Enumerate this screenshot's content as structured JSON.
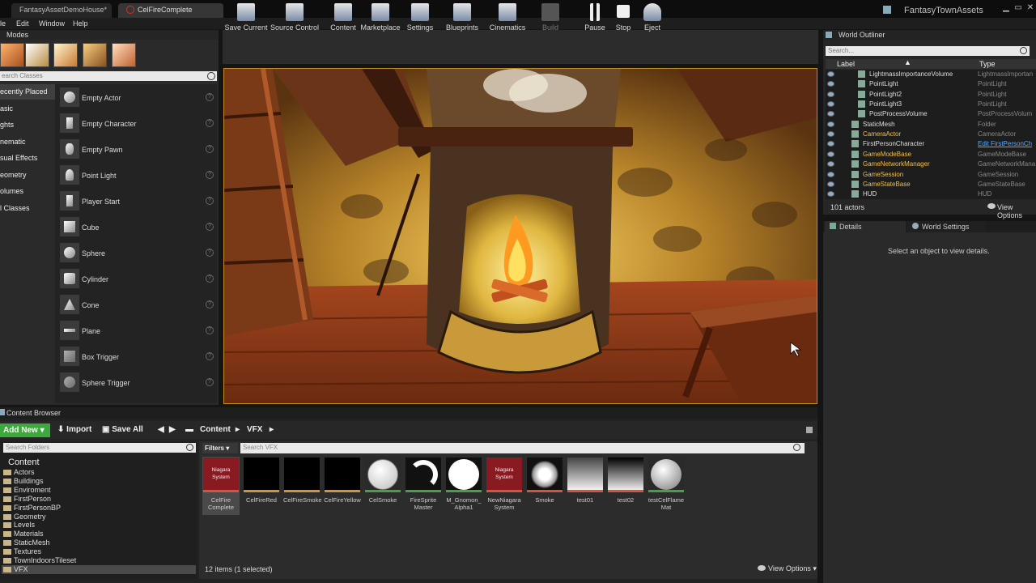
{
  "titlebar": {
    "tabs": [
      {
        "label": "FantasyAssetDemoHouse*"
      },
      {
        "label": "CelFireComplete"
      }
    ],
    "project_name": "FantasyTownAssets"
  },
  "menubar": {
    "items": [
      "le",
      "Edit",
      "Window",
      "Help"
    ]
  },
  "modes": {
    "title": "Modes",
    "search_placeholder": "earch Classes",
    "categories": [
      "ecently Placed",
      "asic",
      "ghts",
      "nematic",
      "sual Effects",
      "eometry",
      "olumes",
      "l Classes"
    ],
    "items": [
      "Empty Actor",
      "Empty Character",
      "Empty Pawn",
      "Point Light",
      "Player Start",
      "Cube",
      "Sphere",
      "Cylinder",
      "Cone",
      "Plane",
      "Box Trigger",
      "Sphere Trigger"
    ],
    "help_glyph": "?"
  },
  "toolbar": {
    "buttons": [
      {
        "label": "Save Current",
        "icon": "save-icon"
      },
      {
        "label": "Source Control",
        "icon": "source-control-icon"
      },
      {
        "label": "Content",
        "icon": "content-icon"
      },
      {
        "label": "Marketplace",
        "icon": "marketplace-icon"
      },
      {
        "label": "Settings",
        "icon": "settings-icon"
      },
      {
        "label": "Blueprints",
        "icon": "blueprints-icon"
      },
      {
        "label": "Cinematics",
        "icon": "cinematics-icon"
      },
      {
        "label": "Build",
        "icon": "build-icon"
      },
      {
        "label": "Pause",
        "icon": "pause-icon"
      },
      {
        "label": "Stop",
        "icon": "stop-icon"
      },
      {
        "label": "Eject",
        "icon": "eject-icon"
      }
    ]
  },
  "outliner": {
    "title": "World Outliner",
    "search_placeholder": "Search...",
    "col_label": "Label",
    "col_type": "Type",
    "rows": [
      {
        "label": "LightmassImportanceVolume",
        "type": "LightmassImportan",
        "indent": 2
      },
      {
        "label": "PointLight",
        "type": "PointLight",
        "indent": 2
      },
      {
        "label": "PointLight2",
        "type": "PointLight",
        "indent": 2
      },
      {
        "label": "PointLight3",
        "type": "PointLight",
        "indent": 2
      },
      {
        "label": "PostProcessVolume",
        "type": "PostProcessVolum",
        "indent": 2
      },
      {
        "label": "StaticMesh",
        "type": "Folder",
        "indent": 1
      },
      {
        "label": "CameraActor",
        "type": "CameraActor",
        "indent": 1,
        "highlight": true
      },
      {
        "label": "FirstPersonCharacter",
        "type": "Edit FirstPersonCh",
        "indent": 1,
        "link": true
      },
      {
        "label": "GameModeBase",
        "type": "GameModeBase",
        "indent": 1,
        "highlight": true
      },
      {
        "label": "GameNetworkManager",
        "type": "GameNetworkMana",
        "indent": 1,
        "highlight": true
      },
      {
        "label": "GameSession",
        "type": "GameSession",
        "indent": 1,
        "highlight": true
      },
      {
        "label": "GameStateBase",
        "type": "GameStateBase",
        "indent": 1,
        "highlight": true
      },
      {
        "label": "HUD",
        "type": "HUD",
        "indent": 1
      }
    ],
    "count": "101 actors",
    "view_options": "View Options"
  },
  "details": {
    "tabs": [
      "Details",
      "World Settings"
    ],
    "empty_text": "Select an object to view details."
  },
  "content_browser": {
    "title": "Content Browser",
    "add_new": "Add New",
    "import": "Import",
    "save_all": "Save All",
    "path": [
      "Content",
      "VFX"
    ],
    "search_folders": "Search Folders",
    "folders_root": "Content",
    "folders": [
      "Actors",
      "Buildings",
      "Enviroment",
      "FirstPerson",
      "FirstPersonBP",
      "Geometry",
      "Levels",
      "Materials",
      "StaticMesh",
      "Textures",
      "TownIndoorsTileset",
      "VFX"
    ],
    "filters": "Filters",
    "search_assets": "Search VFX",
    "assets": [
      {
        "name": "CelFire Complete",
        "kind": "niagara",
        "thumb_text": "Niagara System",
        "selected": true
      },
      {
        "name": "CelFireRed",
        "kind": "black"
      },
      {
        "name": "CelFireSmoke",
        "kind": "black"
      },
      {
        "name": "CelFireYellow",
        "kind": "black"
      },
      {
        "name": "CelSmoke",
        "kind": "sphere-lines"
      },
      {
        "name": "FireSprite Master",
        "kind": "swirl"
      },
      {
        "name": "M_Gnomon_ Alpha1",
        "kind": "white-circle"
      },
      {
        "name": "NewNiagara System",
        "kind": "niagara",
        "thumb_text": "Niagara System"
      },
      {
        "name": "Smoke",
        "kind": "smoke"
      },
      {
        "name": "test01",
        "kind": "gradient-light"
      },
      {
        "name": "test02",
        "kind": "gradient-dark"
      },
      {
        "name": "testCelFlame Mat",
        "kind": "sphere-dark"
      }
    ],
    "status": "12 items (1 selected)",
    "view_options": "View Options"
  }
}
